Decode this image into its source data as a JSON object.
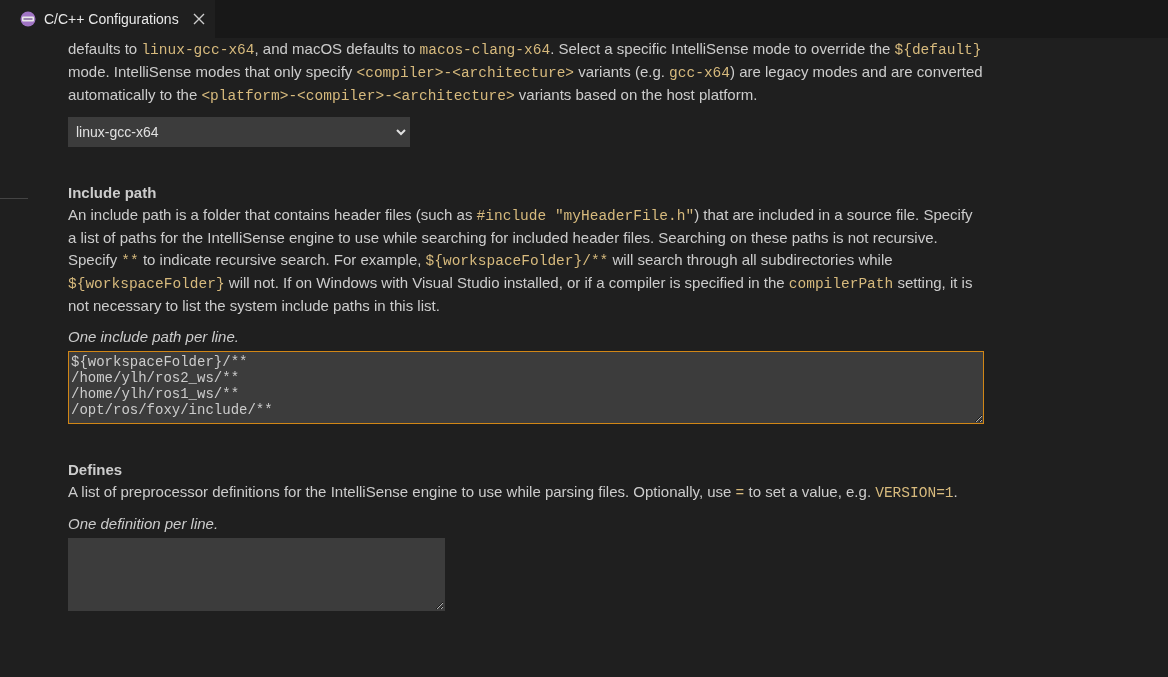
{
  "tab": {
    "title": "C/C++ Configurations",
    "selected": true
  },
  "mode": {
    "description": [
      {
        "text": "defaults to ",
        "kind": "text"
      },
      {
        "text": "linux-gcc-x64",
        "kind": "code"
      },
      {
        "text": ", and macOS defaults to ",
        "kind": "text"
      },
      {
        "text": "macos-clang-x64",
        "kind": "code"
      },
      {
        "text": ". Select a specific IntelliSense mode to override the ",
        "kind": "text"
      },
      {
        "text": "${default}",
        "kind": "code"
      },
      {
        "text": " mode. IntelliSense modes that only specify ",
        "kind": "text"
      },
      {
        "text": "<compiler>-<architecture>",
        "kind": "code"
      },
      {
        "text": " variants (e.g. ",
        "kind": "text"
      },
      {
        "text": "gcc-x64",
        "kind": "code"
      },
      {
        "text": ") are legacy modes and are converted automatically to the ",
        "kind": "text"
      },
      {
        "text": "<platform>-<compiler>-<architecture>",
        "kind": "code"
      },
      {
        "text": " variants based on the host platform.",
        "kind": "text"
      }
    ],
    "value": "linux-gcc-x64"
  },
  "include_path": {
    "title": "Include path",
    "description": [
      {
        "text": "An include path is a folder that contains header files (such as ",
        "kind": "text"
      },
      {
        "text": "#include \"myHeaderFile.h\"",
        "kind": "code"
      },
      {
        "text": ") that are included in a source file. Specify a list of paths for the IntelliSense engine to use while searching for included header files. Searching on these paths is not recursive. Specify ",
        "kind": "text"
      },
      {
        "text": "**",
        "kind": "code"
      },
      {
        "text": " to indicate recursive search. For example, ",
        "kind": "text"
      },
      {
        "text": "${workspaceFolder}/**",
        "kind": "code"
      },
      {
        "text": " will search through all subdirectories while ",
        "kind": "text"
      },
      {
        "text": "${workspaceFolder}",
        "kind": "code"
      },
      {
        "text": " will not. If on Windows with Visual Studio installed, or if a compiler is specified in the ",
        "kind": "text"
      },
      {
        "text": "compilerPath",
        "kind": "code"
      },
      {
        "text": " setting, it is not necessary to list the system include paths in this list.",
        "kind": "text"
      }
    ],
    "hint": "One include path per line.",
    "value": [
      "${workspaceFolder}/**",
      "/home/ylh/ros2_ws/**",
      "/home/ylh/ros1_ws/**",
      "/opt/ros/foxy/include/**"
    ],
    "focused": true
  },
  "defines": {
    "title": "Defines",
    "description": [
      {
        "text": "A list of preprocessor definitions for the IntelliSense engine to use while parsing files. Optionally, use ",
        "kind": "text"
      },
      {
        "text": "=",
        "kind": "code"
      },
      {
        "text": " to set a value, e.g. ",
        "kind": "text"
      },
      {
        "text": "VERSION=1",
        "kind": "code"
      },
      {
        "text": ".",
        "kind": "text"
      }
    ],
    "hint": "One definition per line.",
    "focused": false
  }
}
